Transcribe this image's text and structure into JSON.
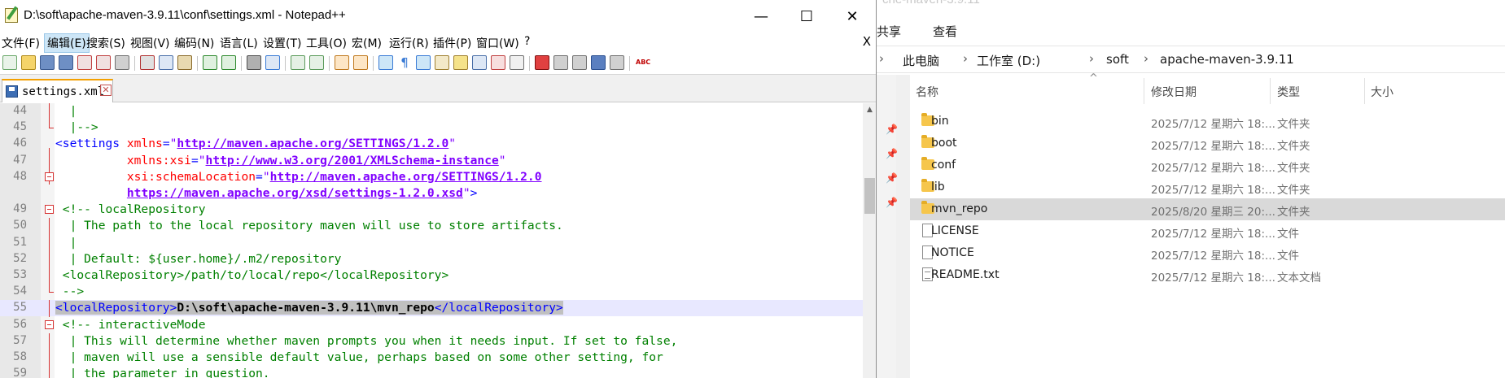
{
  "explorer": {
    "ghost_title": "che-maven-3.9.11",
    "ribbon_tabs": [
      "共享",
      "查看"
    ],
    "breadcrumb": [
      "此电脑",
      "工作室 (D:)",
      "soft",
      "apache-maven-3.9.11"
    ],
    "columns": [
      "名称",
      "修改日期",
      "类型",
      "大小"
    ],
    "files": [
      {
        "name": "bin",
        "date": "2025/7/12 星期六 18:...",
        "type": "文件夹",
        "kind": "folder"
      },
      {
        "name": "boot",
        "date": "2025/7/12 星期六 18:...",
        "type": "文件夹",
        "kind": "folder"
      },
      {
        "name": "conf",
        "date": "2025/7/12 星期六 18:...",
        "type": "文件夹",
        "kind": "folder"
      },
      {
        "name": "lib",
        "date": "2025/7/12 星期六 18:...",
        "type": "文件夹",
        "kind": "folder"
      },
      {
        "name": "mvn_repo",
        "date": "2025/8/20 星期三 20:...",
        "type": "文件夹",
        "kind": "folder",
        "selected": true
      },
      {
        "name": "LICENSE",
        "date": "2025/7/12 星期六 18:...",
        "type": "文件",
        "kind": "file"
      },
      {
        "name": "NOTICE",
        "date": "2025/7/12 星期六 18:...",
        "type": "文件",
        "kind": "file"
      },
      {
        "name": "README.txt",
        "date": "2025/7/12 星期六 18:...",
        "type": "文本文档",
        "kind": "txt"
      }
    ]
  },
  "npp": {
    "title": "D:\\soft\\apache-maven-3.9.11\\conf\\settings.xml - Notepad++",
    "window_buttons": {
      "minimize": "—",
      "maximize": "☐",
      "close": "✕"
    },
    "menu": [
      "文件(F)",
      "编辑(E)",
      "搜索(S)",
      "视图(V)",
      "编码(N)",
      "语言(L)",
      "设置(T)",
      "工具(O)",
      "宏(M)",
      "运行(R)",
      "插件(P)",
      "窗口(W)",
      "?"
    ],
    "menu_active_index": 1,
    "menu_close": "X",
    "tab": {
      "label": "settings.xml",
      "close": "✕"
    },
    "lines": [
      {
        "num": "44",
        "segments": [
          {
            "t": "  |",
            "c": "comment"
          }
        ]
      },
      {
        "num": "45",
        "segments": [
          {
            "t": "  |-->",
            "c": "comment"
          }
        ]
      },
      {
        "num": "46",
        "segments": [
          {
            "t": "<settings ",
            "c": "tag"
          },
          {
            "t": "xmlns",
            "c": "attr"
          },
          {
            "t": "=",
            "c": "tag"
          },
          {
            "t": "\"",
            "c": "q"
          },
          {
            "t": "http://maven.apache.org/SETTINGS/1.2.0",
            "c": "url"
          },
          {
            "t": "\"",
            "c": "q"
          }
        ]
      },
      {
        "num": "47",
        "segments": [
          {
            "t": "          ",
            "c": "plain"
          },
          {
            "t": "xmlns:xsi",
            "c": "attr"
          },
          {
            "t": "=",
            "c": "tag"
          },
          {
            "t": "\"",
            "c": "q"
          },
          {
            "t": "http://www.w3.org/2001/XMLSchema-instance",
            "c": "url"
          },
          {
            "t": "\"",
            "c": "q"
          }
        ]
      },
      {
        "num": "48",
        "segments": [
          {
            "t": "          ",
            "c": "plain"
          },
          {
            "t": "xsi:schemaLocation",
            "c": "attr"
          },
          {
            "t": "=",
            "c": "tag"
          },
          {
            "t": "\"",
            "c": "q"
          },
          {
            "t": "http://maven.apache.org/SETTINGS/1.2.0",
            "c": "url"
          }
        ]
      },
      {
        "num": "",
        "segments": [
          {
            "t": "          ",
            "c": "plain"
          },
          {
            "t": "https://maven.apache.org/xsd/settings-1.2.0.xsd",
            "c": "url"
          },
          {
            "t": "\"",
            "c": "q"
          },
          {
            "t": ">",
            "c": "tag"
          }
        ]
      },
      {
        "num": "49",
        "segments": [
          {
            "t": " <!-- localRepository",
            "c": "comment"
          }
        ]
      },
      {
        "num": "50",
        "segments": [
          {
            "t": "  | The path to the local repository maven will use to store artifacts.",
            "c": "comment"
          }
        ]
      },
      {
        "num": "51",
        "segments": [
          {
            "t": "  |",
            "c": "comment"
          }
        ]
      },
      {
        "num": "52",
        "segments": [
          {
            "t": "  | Default: ${user.home}/.m2/repository",
            "c": "comment"
          }
        ]
      },
      {
        "num": "53",
        "segments": [
          {
            "t": " <localRepository>/path/to/local/repo</localRepository>",
            "c": "comment"
          }
        ]
      },
      {
        "num": "54",
        "segments": [
          {
            "t": " -->",
            "c": "comment"
          }
        ]
      },
      {
        "num": "55",
        "current": true,
        "segments": [
          {
            "t": "<localRepository>",
            "c": "tag"
          },
          {
            "t": "D:\\soft\\apache-maven-3.9.11\\mvn_repo",
            "c": "text"
          },
          {
            "t": "</localRepository>",
            "c": "tag"
          }
        ]
      },
      {
        "num": "56",
        "segments": [
          {
            "t": " <!-- interactiveMode",
            "c": "comment"
          }
        ]
      },
      {
        "num": "57",
        "segments": [
          {
            "t": "  | This will determine whether maven prompts you when it needs input. If set to false,",
            "c": "comment"
          }
        ]
      },
      {
        "num": "58",
        "segments": [
          {
            "t": "  | maven will use a sensible default value, perhaps based on some other setting, for",
            "c": "comment"
          }
        ]
      },
      {
        "num": "59",
        "segments": [
          {
            "t": "  | the parameter in question.",
            "c": "comment"
          }
        ]
      }
    ]
  },
  "colors": {
    "comment": "#008000",
    "tag": "#0000ff",
    "attr": "#ff0000",
    "url": "#8000ff",
    "current_line": "#e8e8ff",
    "selected_row": "#d9d9d9",
    "folder": "#f6c64c",
    "tab_accent": "#f4a000"
  }
}
